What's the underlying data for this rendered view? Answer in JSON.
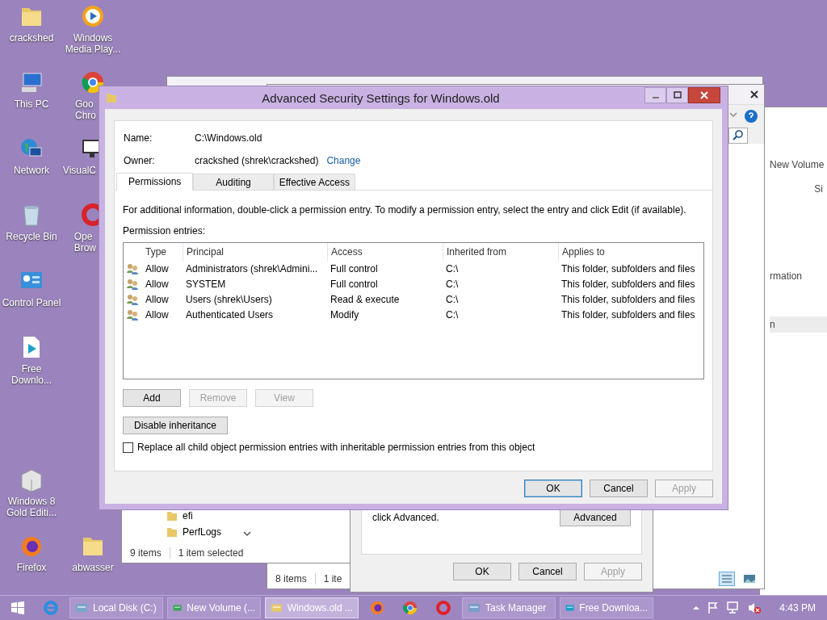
{
  "desktop_icons": [
    {
      "lines": [
        "crackshed"
      ]
    },
    {
      "lines": [
        "Windows",
        "Media Play..."
      ]
    },
    {
      "lines": [
        "This PC"
      ]
    },
    {
      "lines": [
        "Goo",
        "Chro"
      ]
    },
    {
      "lines": [
        "Network"
      ]
    },
    {
      "lines": [
        "VisualC"
      ]
    },
    {
      "lines": [
        "Recycle Bin"
      ]
    },
    {
      "lines": [
        "Ope",
        "Brow"
      ]
    },
    {
      "lines": [
        "Control Panel"
      ]
    },
    {
      "lines": [
        "Free",
        "Downlo..."
      ]
    },
    {
      "lines": [
        "Windows 8",
        "Gold Editi..."
      ]
    },
    {
      "lines": [
        "Firefox"
      ]
    },
    {
      "lines": [
        "abwasser"
      ]
    }
  ],
  "explorer_right": {
    "address": "New Volume",
    "column_header": "Si",
    "detail_text": "rmation",
    "band_text": "n"
  },
  "explorer_back": {
    "status": [
      "8 items",
      "1 ite"
    ]
  },
  "explorer_front": {
    "tree_items": [
      "efi",
      "PerfLogs"
    ],
    "status": [
      "9 items",
      "1 item selected"
    ]
  },
  "properties_dialog": {
    "text": "click Advanced.",
    "advanced_button": "Advanced",
    "buttons": [
      {
        "label": "OK",
        "disabled": false
      },
      {
        "label": "Cancel",
        "disabled": false
      },
      {
        "label": "Apply",
        "disabled": true
      }
    ]
  },
  "dialog": {
    "title": "Advanced Security Settings for Windows.old",
    "name_label": "Name:",
    "name_value": "C:\\Windows.old",
    "owner_label": "Owner:",
    "owner_value": "crackshed (shrek\\crackshed)",
    "owner_link": "Change",
    "tabs": [
      {
        "label": "Permissions",
        "selected": true
      },
      {
        "label": "Auditing",
        "selected": false
      },
      {
        "label": "Effective Access",
        "selected": false
      }
    ],
    "instructions": "For additional information, double-click a permission entry. To modify a permission entry, select the entry and click Edit (if available).",
    "entries_label": "Permission entries:",
    "columns": [
      "Type",
      "Principal",
      "Access",
      "Inherited from",
      "Applies to"
    ],
    "rows": [
      {
        "type": "Allow",
        "principal": "Administrators (shrek\\Admini...",
        "access": "Full control",
        "inherited_from": "C:\\",
        "applies_to": "This folder, subfolders and files"
      },
      {
        "type": "Allow",
        "principal": "SYSTEM",
        "access": "Full control",
        "inherited_from": "C:\\",
        "applies_to": "This folder, subfolders and files"
      },
      {
        "type": "Allow",
        "principal": "Users (shrek\\Users)",
        "access": "Read & execute",
        "inherited_from": "C:\\",
        "applies_to": "This folder, subfolders and files"
      },
      {
        "type": "Allow",
        "principal": "Authenticated Users",
        "access": "Modify",
        "inherited_from": "C:\\",
        "applies_to": "This folder, subfolders and files"
      }
    ],
    "actions": [
      {
        "label": "Add",
        "disabled": false
      },
      {
        "label": "Remove",
        "disabled": true
      },
      {
        "label": "View",
        "disabled": true
      }
    ],
    "inheritance_button": "Disable inheritance",
    "replace_checkbox": {
      "label": "Replace all child object permission entries with inheritable permission entries from this object",
      "checked": false
    },
    "buttons": [
      {
        "label": "OK",
        "disabled": false,
        "default": true
      },
      {
        "label": "Cancel",
        "disabled": false,
        "default": false
      },
      {
        "label": "Apply",
        "disabled": true,
        "default": false
      }
    ]
  },
  "taskbar": {
    "items": [
      {
        "kind": "start"
      },
      {
        "kind": "pin"
      },
      {
        "kind": "task",
        "label": "Local Disk (C:)",
        "selected": false
      },
      {
        "kind": "task",
        "label": "New Volume (...",
        "selected": false
      },
      {
        "kind": "task",
        "label": "Windows.old ...",
        "selected": true
      },
      {
        "kind": "pin"
      },
      {
        "kind": "pin"
      },
      {
        "kind": "pin"
      },
      {
        "kind": "task",
        "label": "Task Manager",
        "selected": false
      },
      {
        "kind": "task",
        "label": "Free Downloa...",
        "selected": false
      }
    ],
    "clock": "4:43 PM"
  }
}
